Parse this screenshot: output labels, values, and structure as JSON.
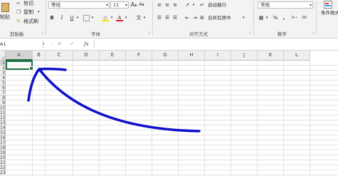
{
  "clipboard": {
    "paste": "粘贴",
    "cut": "剪切",
    "copy": "复制",
    "format_painter": "格式刷",
    "group": "剪贴板"
  },
  "font": {
    "name": "等线",
    "size": "11",
    "bold": "B",
    "italic": "I",
    "underline": "U",
    "grow": "A",
    "shrink": "A",
    "wen": "文",
    "font_color_glyph": "A",
    "group": "字体"
  },
  "alignment": {
    "wrap": "自动换行",
    "merge": "合并后居中",
    "group": "对齐方式"
  },
  "number": {
    "format": "常规",
    "percent": "%",
    "comma": ",",
    "group": "数字"
  },
  "styles": {
    "conditional": "条件格式"
  },
  "formula_bar": {
    "name_box": "A1",
    "cancel": "✕",
    "enter": "✓",
    "fx": "fx",
    "value": ""
  },
  "sheet": {
    "columns": [
      "A",
      "B",
      "C",
      "D",
      "E",
      "F",
      "G",
      "H",
      "I",
      "J",
      "K",
      "L"
    ],
    "rows": [
      "1",
      "2",
      "3",
      "4",
      "5",
      "6",
      "7",
      "8",
      "9",
      "10",
      "11",
      "12",
      "13",
      "14",
      "15",
      "16",
      "17",
      "18",
      "19",
      "20",
      "21",
      "22",
      "23"
    ],
    "selected_cell": "A1",
    "annotation_color": "#1010c8"
  },
  "colors": {
    "ribbon_bg": "#f3f3f3",
    "font_red": "#e02020",
    "fill_yellow": "#ffe000"
  }
}
